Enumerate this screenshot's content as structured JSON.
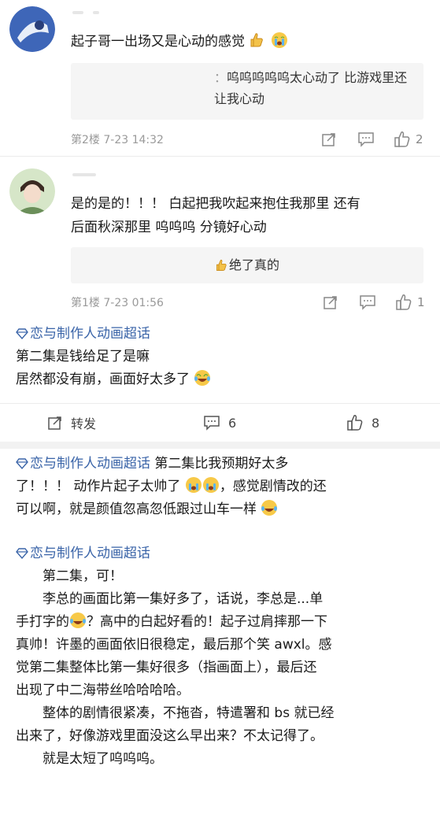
{
  "comments": [
    {
      "text": "起子哥一出场又是心动的感觉",
      "reply_prefix": "：",
      "reply_text": "呜呜呜呜呜太心动了 比游戏里还让我心动",
      "meta": "第2楼 7-23 14:32",
      "likes": "2"
    },
    {
      "text_line1": "是的是的！！！ 白起把我吹起来抱住我那里 还有",
      "text_line2": "后面秋深那里 呜呜呜 分镜好心动",
      "reply_text": "绝了真的",
      "meta": "第1楼 7-23 01:56",
      "likes": "1"
    }
  ],
  "topic_label": "恋与制作人动画超话",
  "post1": {
    "line1": "第二集是钱给足了是嘛",
    "line2": "居然都没有崩，画面好太多了",
    "repost_label": "转发",
    "comment_count": "6",
    "like_count": "8"
  },
  "post2": {
    "line1_suffix": "第二集比我预期好太多",
    "line2_a": "了！！！ 动作片起子太帅了",
    "line2_b": "，感觉剧情改的还",
    "line3": "可以啊，就是颜值忽高忽低跟过山车一样"
  },
  "post3": {
    "p1": "第二集，可！",
    "p2_a": "李总的画面比第一集好多了，话说，李总是...单",
    "p2_b": "手打字的",
    "p2_c": "？高中的白起好看的！起子过肩摔那一下",
    "p2_d": "真帅！许墨的画面依旧很稳定，最后那个笑 awxl。感",
    "p2_e": "觉第二集整体比第一集好很多（指画面上），最后还",
    "p2_f": "出现了中二海带丝哈哈哈哈。",
    "p3_a": "整体的剧情很紧凑，不拖沓，特遣署和 bs 就已经",
    "p3_b": "出来了，好像游戏里面没这么早出来？不太记得了。",
    "p4": "就是太短了呜呜呜。"
  },
  "colors": {
    "topic": "#3a64a8",
    "meta": "#9a9a9a",
    "reply_bg": "#f5f5f5",
    "separator": "#f2f2f2"
  },
  "icons": [
    "thumbs-up-emoji",
    "crying-emoji",
    "laughing-crying-emoji",
    "share-icon",
    "comment-icon",
    "like-icon",
    "diamond-topic-icon"
  ]
}
